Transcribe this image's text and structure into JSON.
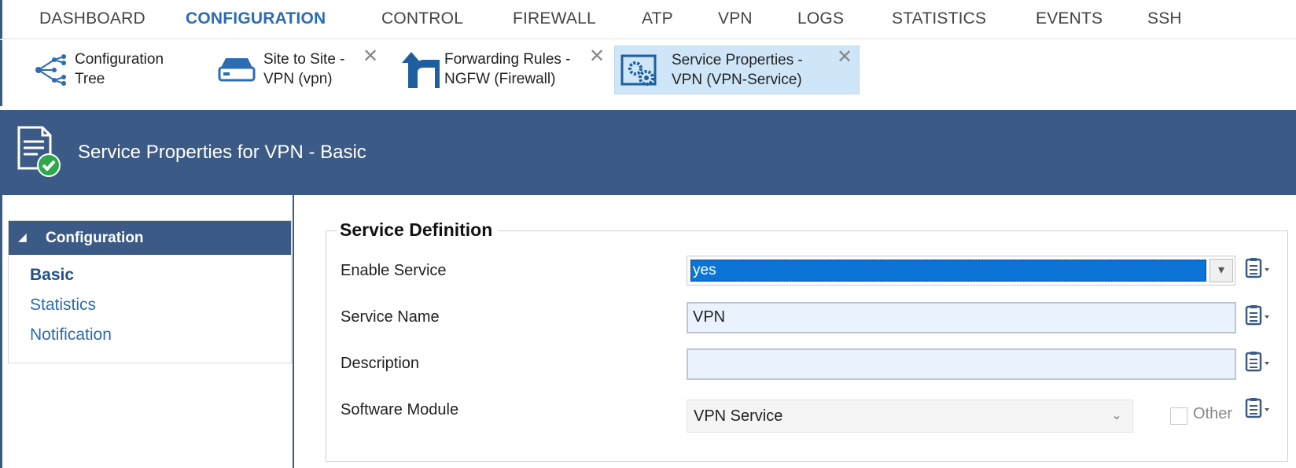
{
  "nav": {
    "items": [
      "DASHBOARD",
      "CONFIGURATION",
      "CONTROL",
      "FIREWALL",
      "ATP",
      "VPN",
      "LOGS",
      "STATISTICS",
      "EVENTS",
      "SSH"
    ],
    "active": "CONFIGURATION"
  },
  "tabs": [
    {
      "label_line1": "Configuration",
      "label_line2": "Tree",
      "icon": "configuration-tree-icon",
      "closable": false
    },
    {
      "label_line1": "Site to Site -",
      "label_line2": "VPN (vpn)",
      "icon": "vpn-drive-icon",
      "closable": true
    },
    {
      "label_line1": "Forwarding Rules -",
      "label_line2": "NGFW (Firewall)",
      "icon": "forwarding-arrow-icon",
      "closable": true
    },
    {
      "label_line1": "Service Properties -",
      "label_line2": "VPN (VPN-Service)",
      "icon": "service-gears-icon",
      "closable": true,
      "active": true
    }
  ],
  "tab_close_symbol": "✕",
  "title": "Service Properties for VPN - Basic",
  "sidebar": {
    "section_title": "Configuration",
    "items": [
      "Basic",
      "Statistics",
      "Notification"
    ],
    "active": "Basic"
  },
  "form": {
    "legend": "Service Definition",
    "fields": {
      "enable_service": {
        "label": "Enable Service",
        "value": "yes"
      },
      "service_name": {
        "label": "Service Name",
        "value": "VPN"
      },
      "description": {
        "label": "Description",
        "value": ""
      },
      "software_module": {
        "label": "Software Module",
        "value": "VPN Service",
        "other_label": "Other",
        "other_checked": false
      }
    }
  },
  "colors": {
    "brand": "#3c5a86",
    "active_nav": "#2b6cb3",
    "selection": "#0b74d6",
    "input_bg": "#eaf3fd",
    "tab_active_bg": "#cfe6f8",
    "status_ok": "#2ea84a"
  }
}
